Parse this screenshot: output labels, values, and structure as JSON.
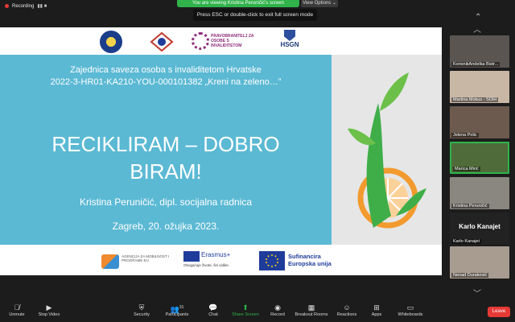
{
  "topbar": {
    "recording_label": "Recording",
    "viewing_text": "You are viewing Kristina Peruničić's screen",
    "view_options_label": "View Options",
    "esc_hint": "Press ESC or double-click to exit full screen mode"
  },
  "slide": {
    "logo3_text": "PRAVOBRANITELJ ZA OSOBE S INVALIDITETOM",
    "logo4_text": "HSGN",
    "org_line1": "Zajednica saveza osoba s invaliditetom Hrvatske",
    "org_line2": "2022-3-HR01-KA210-YOU-000101382 „Kreni na zeleno…”",
    "title_line1": "RECIKLIRAM – DOBRO",
    "title_line2": "BIRAM!",
    "author": "Kristina Peruničić, dipl. socijalna radnica",
    "date": "Zagreb, 20. ožujka 2023.",
    "footer": {
      "azvo_text": "AGENCIJA ZA MOBILNOST I PROGRAME EU",
      "erasmus_text": "Erasmus+",
      "erasmus_sub": "Obogaćuje živote, širi vidike.",
      "eu_text": "Sufinancira Europska unija"
    }
  },
  "participants": [
    {
      "name": "KorisnikAndelka Bistr..."
    },
    {
      "name": "Martina Mokus - SOIH"
    },
    {
      "name": "Jelena Polic"
    },
    {
      "name": "Marica Mirić"
    },
    {
      "name": "Kristina Peruničić"
    },
    {
      "name": "Karlo Kanajet",
      "name_only": true
    },
    {
      "name": "Nenad Duraković"
    }
  ],
  "toolbar": {
    "unmute": "Unmute",
    "stop_video": "Stop Video",
    "security": "Security",
    "participants": "Participants",
    "participants_count": "31",
    "chat": "Chat",
    "share_screen": "Share Screen",
    "record": "Record",
    "breakout_rooms": "Breakout Rooms",
    "reactions": "Reactions",
    "apps": "Apps",
    "whiteboards": "Whiteboards",
    "leave": "Leave"
  },
  "colors": {
    "slide_blue": "#5bb9d4",
    "leave_red": "#e53935",
    "share_green": "#2fb34a"
  }
}
